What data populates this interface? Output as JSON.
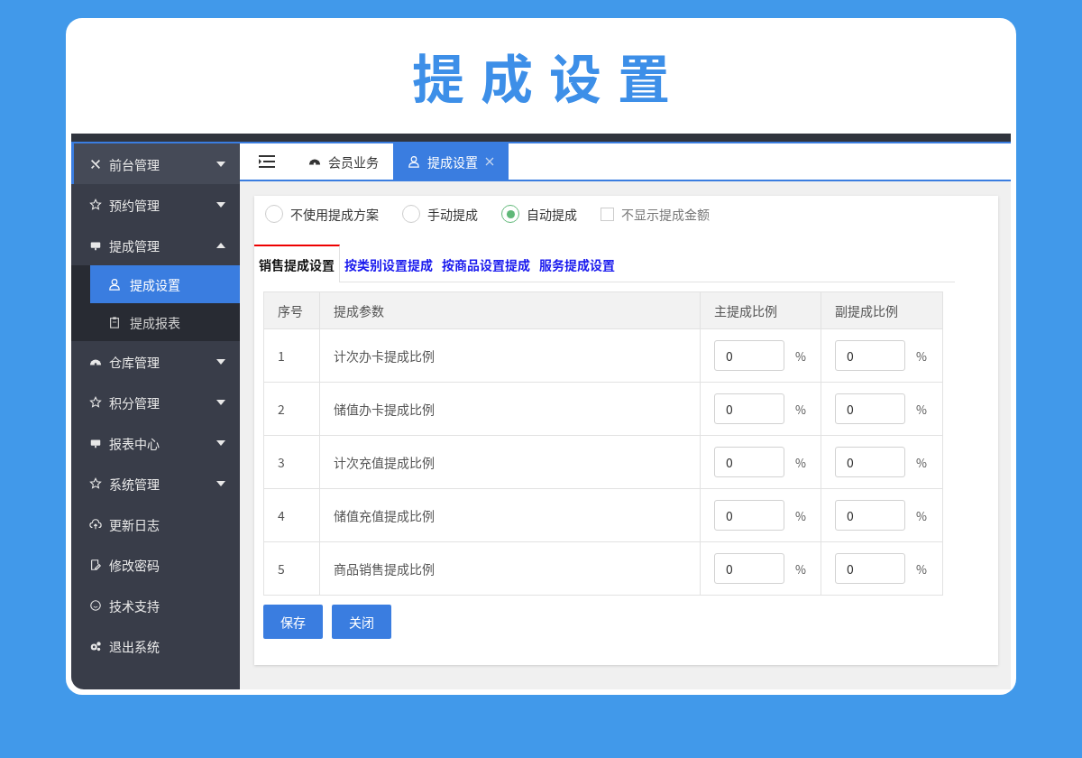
{
  "page_title": "提成设置",
  "sidebar": {
    "items": [
      {
        "label": "前台管理",
        "has_caret": true,
        "expanded": false,
        "selected": true
      },
      {
        "label": "预约管理",
        "has_caret": true,
        "expanded": false,
        "selected": false
      },
      {
        "label": "提成管理",
        "has_caret": true,
        "expanded": true,
        "selected": false,
        "children": [
          {
            "label": "提成设置",
            "selected": true
          },
          {
            "label": "提成报表",
            "selected": false
          }
        ]
      },
      {
        "label": "仓库管理",
        "has_caret": true,
        "expanded": false,
        "selected": false
      },
      {
        "label": "积分管理",
        "has_caret": true,
        "expanded": false,
        "selected": false
      },
      {
        "label": "报表中心",
        "has_caret": true,
        "expanded": false,
        "selected": false
      },
      {
        "label": "系统管理",
        "has_caret": true,
        "expanded": false,
        "selected": false
      },
      {
        "label": "更新日志",
        "has_caret": false,
        "selected": false
      },
      {
        "label": "修改密码",
        "has_caret": false,
        "selected": false
      },
      {
        "label": "技术支持",
        "has_caret": false,
        "selected": false
      },
      {
        "label": "退出系统",
        "has_caret": false,
        "selected": false
      }
    ]
  },
  "tabs": [
    {
      "label": "会员业务",
      "selected": false,
      "closable": false
    },
    {
      "label": "提成设置",
      "selected": true,
      "closable": true
    }
  ],
  "options": [
    {
      "kind": "radio",
      "label": "不使用提成方案",
      "selected": false
    },
    {
      "kind": "radio",
      "label": "手动提成",
      "selected": false
    },
    {
      "kind": "radio",
      "label": "自动提成",
      "selected": true
    },
    {
      "kind": "checkbox",
      "label": "不显示提成金额",
      "selected": false
    }
  ],
  "sub_tabs": [
    {
      "label": "销售提成设置",
      "selected": true
    },
    {
      "label": "按类别设置提成",
      "selected": false
    },
    {
      "label": "按商品设置提成",
      "selected": false
    },
    {
      "label": "服务提成设置",
      "selected": false
    }
  ],
  "table": {
    "columns": [
      "序号",
      "提成参数",
      "主提成比例",
      "副提成比例"
    ],
    "rows": [
      {
        "index": "1",
        "name": "计次办卡提成比例",
        "main": "0",
        "main_unit": "%",
        "sub": "0",
        "sub_unit": "%"
      },
      {
        "index": "2",
        "name": "储值办卡提成比例",
        "main": "0",
        "main_unit": "%",
        "sub": "0",
        "sub_unit": "%"
      },
      {
        "index": "3",
        "name": "计次充值提成比例",
        "main": "0",
        "main_unit": "%",
        "sub": "0",
        "sub_unit": "%"
      },
      {
        "index": "4",
        "name": "储值充值提成比例",
        "main": "0",
        "main_unit": "%",
        "sub": "0",
        "sub_unit": "%"
      },
      {
        "index": "5",
        "name": "商品销售提成比例",
        "main": "0",
        "main_unit": "%",
        "sub": "0",
        "sub_unit": "%"
      }
    ]
  },
  "buttons": [
    "保存",
    "关闭"
  ]
}
